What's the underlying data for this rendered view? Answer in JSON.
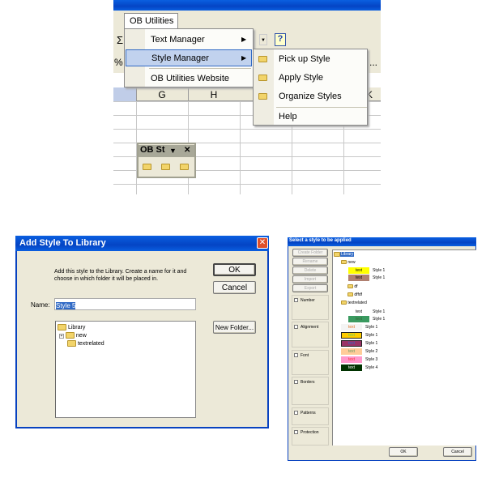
{
  "excel": {
    "menu_tab": "OB Utilities",
    "menu_items": [
      {
        "label": "Text Manager",
        "arrow": "▶"
      },
      {
        "label": "Style Manager",
        "arrow": "▶"
      },
      {
        "label": "OB Utilities Website"
      }
    ],
    "submenu_items": [
      {
        "label": "Pick up Style",
        "icon": "folder-up-icon"
      },
      {
        "label": "Apply Style",
        "icon": "folder-down-icon"
      },
      {
        "label": "Organize Styles",
        "icon": "folder-dots-icon"
      },
      {
        "label": "Help"
      }
    ],
    "columns": [
      "G",
      "H",
      "K"
    ],
    "toolbar_symbols": {
      "sum": "Σ",
      "percent": "%",
      "more": "...",
      "help": "?"
    },
    "float_toolbar": {
      "title": "OB St",
      "close": "✕",
      "dropdown": "▼"
    }
  },
  "add_dialog": {
    "title": "Add Style To Library",
    "instructions": "Add this style to the Library. Create a name for it and choose in which folder it will be placed in.",
    "name_label": "Name:",
    "name_value": "Style 5",
    "ok": "OK",
    "cancel": "Cancel",
    "new_folder": "New Folder...",
    "tree": [
      {
        "label": "Library"
      },
      {
        "label": "new",
        "expander": "+"
      },
      {
        "label": "textrelated"
      }
    ]
  },
  "select_dialog": {
    "title": "Select a style to be applied",
    "buttons": [
      "Create Folder",
      "Rename",
      "Delete",
      "Import",
      "Export"
    ],
    "checkboxes": [
      "Number",
      "Alignment",
      "Font",
      "Borders",
      "Patterns",
      "Protection"
    ],
    "ok": "OK",
    "cancel": "Cancel",
    "tree_root": "Library",
    "folders": [
      "new",
      "df",
      "dffdf",
      "textrelated"
    ],
    "styles": [
      {
        "sample": "text",
        "name": "Style 1",
        "bg": "#ffff00",
        "fg": "#000000"
      },
      {
        "sample": "text",
        "name": "Style 1",
        "bg": "#b08070",
        "fg": "#000000"
      },
      {
        "sample": "text",
        "name": "Style 1",
        "bg": "#ffffff",
        "fg": "#000000"
      },
      {
        "sample": "text",
        "name": "Style 1",
        "bg": "#3a9a60",
        "fg": "#336633"
      },
      {
        "sample": "text",
        "name": "Style 1",
        "bg": "#f4f4f4",
        "fg": "#e07020"
      },
      {
        "sample": "text",
        "name": "Style 1",
        "bg": "#ffcc00",
        "fg": "#66cc66"
      },
      {
        "sample": "text",
        "name": "Style 1",
        "bg": "#993366",
        "fg": "#3366cc"
      },
      {
        "sample": "text",
        "name": "Style 2",
        "bg": "#ffcc99",
        "fg": "#669966"
      },
      {
        "sample": "text",
        "name": "Style 3",
        "bg": "#ff99cc",
        "fg": "#ff3333"
      },
      {
        "sample": "text",
        "name": "Style 4",
        "bg": "#003300",
        "fg": "#ffffff"
      }
    ]
  }
}
